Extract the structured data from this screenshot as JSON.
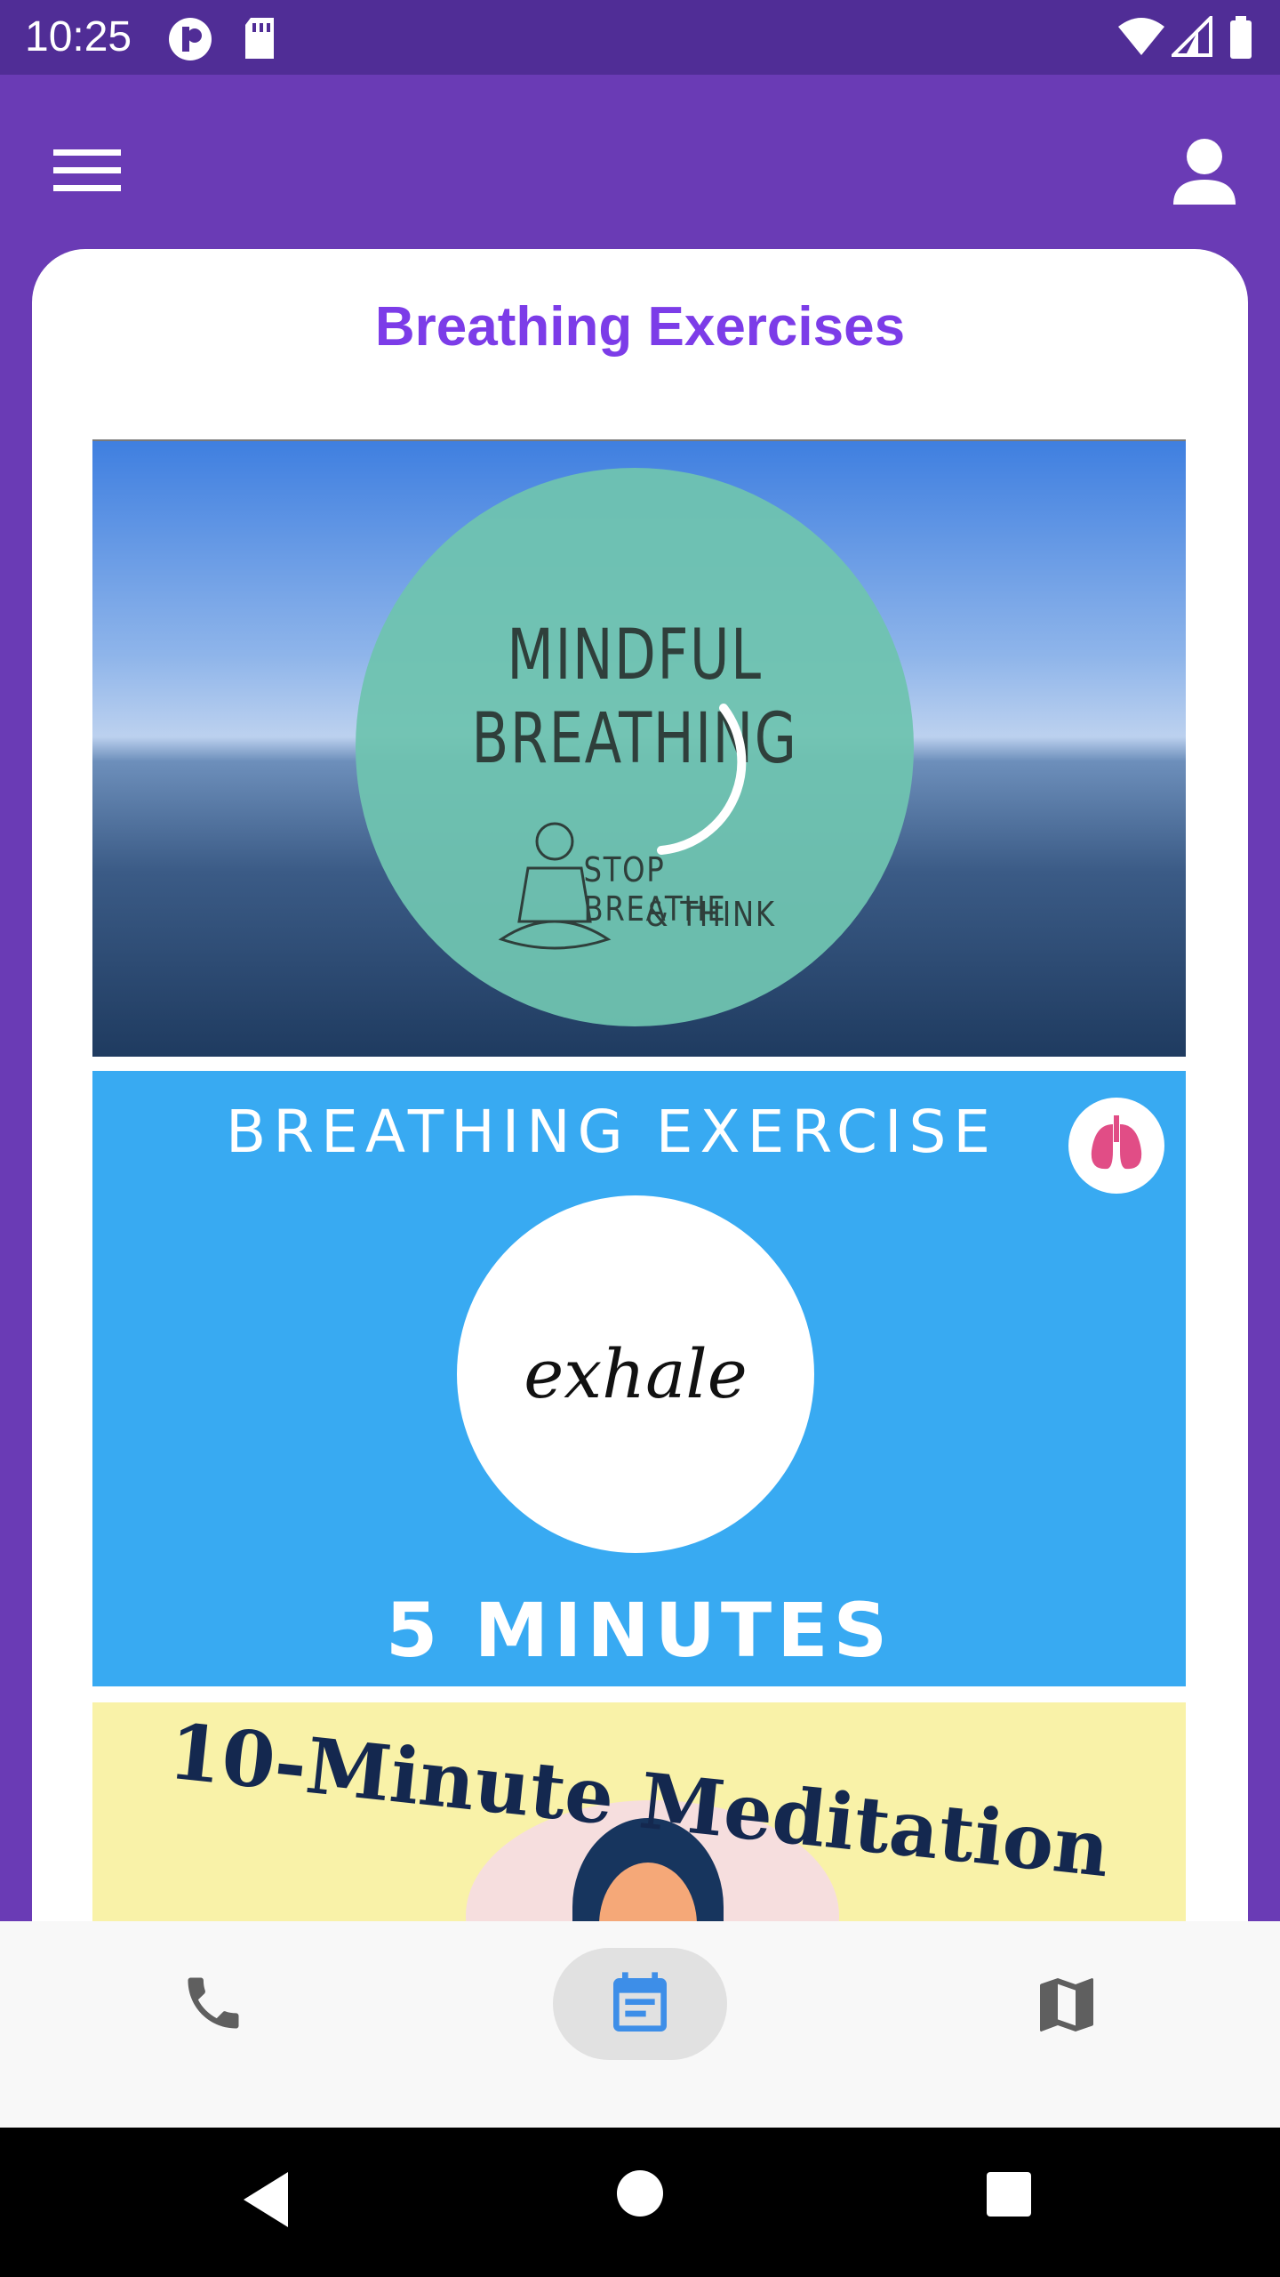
{
  "status_bar": {
    "time": "10:25"
  },
  "app_bar": {
    "menu_icon": "menu-icon",
    "profile_icon": "person-icon"
  },
  "page": {
    "title": "Breathing Exercises"
  },
  "videos": [
    {
      "line1": "MINDFUL",
      "line2": "BREATHING",
      "sub1": "STOP BREATHE",
      "sub2": "& THINK"
    },
    {
      "title": "BREATHING EXERCISE",
      "center": "exhale",
      "footer": "5 MINUTES"
    },
    {
      "title": "10-Minute Meditation"
    }
  ],
  "bottom_nav": {
    "items": [
      {
        "icon": "phone-icon"
      },
      {
        "icon": "event-note-icon",
        "selected": true
      },
      {
        "icon": "map-icon"
      }
    ]
  },
  "colors": {
    "status_bar": "#502d96",
    "app_bar": "#6a3bb5",
    "title": "#7c3ce8",
    "nav_selected_icon": "#3d8ee8"
  }
}
